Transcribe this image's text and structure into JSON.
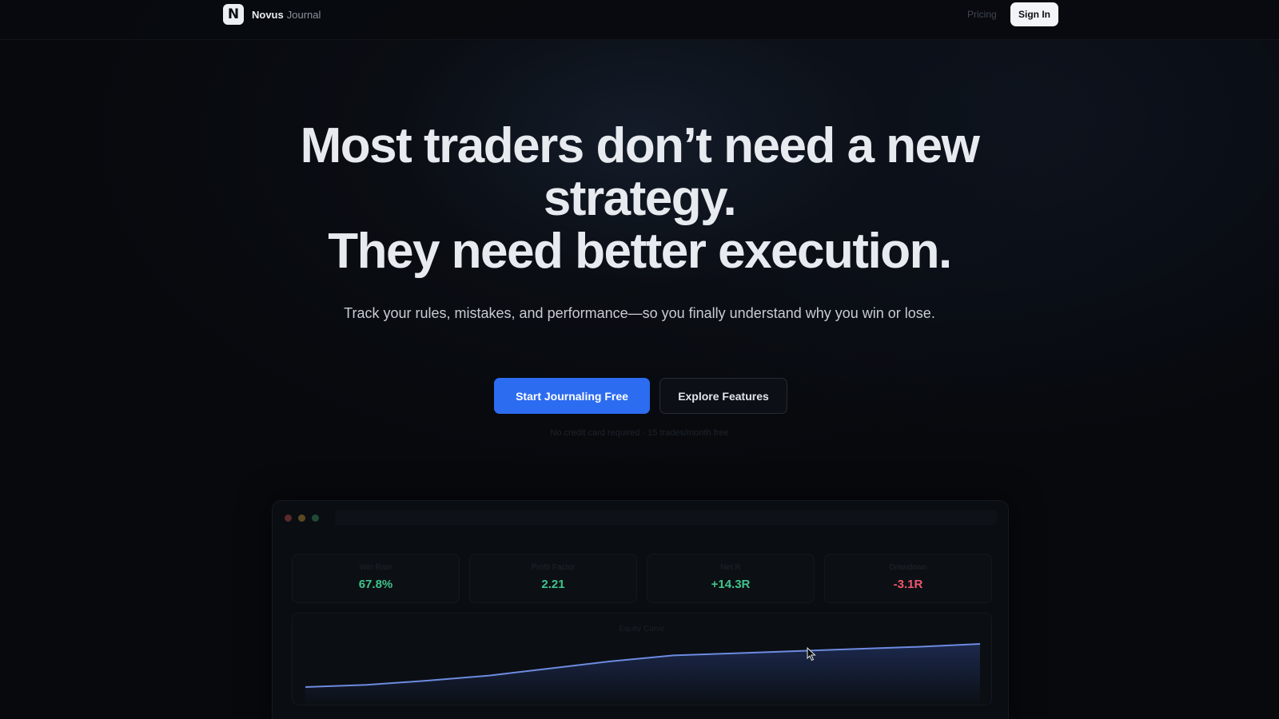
{
  "nav": {
    "logo_letter": "N",
    "brand_name": "Novus",
    "brand_sub": "Journal",
    "pricing_label": "Pricing",
    "signin_label": "Sign In"
  },
  "hero": {
    "headline_line1": "Most traders don’t need a new strategy.",
    "headline_line2": "They need better execution.",
    "subtext": "Track your rules, mistakes, and performance—so you finally understand why you win or lose.",
    "primary_cta": "Start Journaling Free",
    "secondary_cta": "Explore Features",
    "fineprint": "No credit card required · 15 trades/month free"
  },
  "preview": {
    "window_dots": [
      "#5a2a2a",
      "#5a4a22",
      "#1f4a35"
    ],
    "stats": [
      {
        "label": "Win Rate",
        "value": "67.8%",
        "color": "#3fc48a"
      },
      {
        "label": "Profit Factor",
        "value": "2.21",
        "color": "#3fc48a"
      },
      {
        "label": "Net R",
        "value": "+14.3R",
        "color": "#3fc48a"
      },
      {
        "label": "Drawdown",
        "value": "-3.1R",
        "color": "#f0566e"
      }
    ],
    "chart_label": "Equity Curve",
    "equity_curve": [
      0,
      0.3,
      0.9,
      1.6,
      2.6,
      3.6,
      4.4,
      4.7,
      5.0,
      5.3,
      5.6,
      6.0
    ]
  },
  "colors": {
    "accent": "#2c6cf0",
    "line": "#6d8be0",
    "positive": "#3fc48a",
    "negative": "#f0566e"
  }
}
